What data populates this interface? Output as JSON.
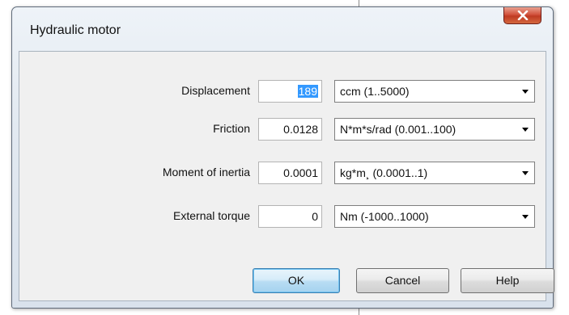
{
  "window": {
    "title": "Hydraulic motor"
  },
  "fields": [
    {
      "label": "Displacement",
      "value": "189",
      "unit": "ccm  (1..5000)"
    },
    {
      "label": "Friction",
      "value": "0.0128",
      "unit": "N*m*s/rad  (0.001..100)"
    },
    {
      "label": "Moment of inertia",
      "value": "0.0001",
      "unit": "kg*m¸  (0.0001..1)"
    },
    {
      "label": "External torque",
      "value": "0",
      "unit": "Nm  (-1000..1000)"
    }
  ],
  "buttons": {
    "ok": "OK",
    "cancel": "Cancel",
    "help": "Help"
  },
  "colors": {
    "close_button": "#c7432b",
    "selection": "#3399ff",
    "ok_border": "#3c7fb1"
  },
  "icons": {
    "close": "close-icon",
    "dropdown": "chevron-down-icon"
  }
}
